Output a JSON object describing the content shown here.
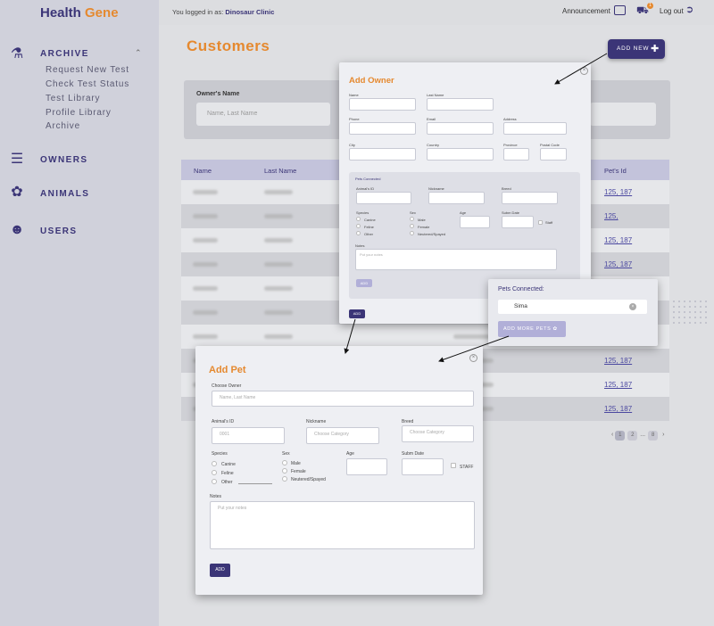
{
  "brand": {
    "part1": "Health",
    "part2": "Gene"
  },
  "topbar": {
    "logged_prefix": "You logged in as:",
    "clinic": "Dinosaur Clinic",
    "announcement": "Announcement",
    "notif_count": "1",
    "logout": "Log out"
  },
  "sidebar": {
    "archive": {
      "label": "ARCHIVE",
      "items": [
        "Request New Test",
        "Check Test Status",
        "Test Library",
        "Profile Library",
        "Archive"
      ]
    },
    "owners": "OWNERS",
    "animals": "ANIMALS",
    "users": "USERS"
  },
  "page": {
    "title": "Customers",
    "add_new": "ADD NEW"
  },
  "filter": {
    "label": "Owner's Name",
    "placeholder": "Name, Last Name"
  },
  "table": {
    "headers": [
      "Name",
      "Last Name",
      "Pet's Id"
    ],
    "rows": [
      {
        "pet_ids": "125, 187"
      },
      {
        "pet_ids": "125,"
      },
      {
        "pet_ids": "125, 187"
      },
      {
        "pet_ids": "125, 187"
      },
      {
        "pet_ids": ""
      },
      {
        "pet_ids": ""
      },
      {
        "pet_ids": ""
      },
      {
        "pet_ids": "125, 187"
      },
      {
        "pet_ids": "125, 187"
      },
      {
        "pet_ids": "125, 187"
      }
    ]
  },
  "pager": {
    "pages": [
      "1",
      "2",
      "...",
      "8"
    ]
  },
  "add_owner": {
    "title": "Add Owner",
    "labels": {
      "name": "Name",
      "last_name": "Last Name",
      "phone": "Phone",
      "email": "Email",
      "address": "Address",
      "city": "City",
      "country": "Country",
      "province": "Province",
      "postal": "Postal Code"
    },
    "pets": {
      "title": "Pets Connected",
      "animal_id": "Animal's ID",
      "nickname": "Nickname",
      "breed": "Breed",
      "species": "Species",
      "species_opts": [
        "Canine",
        "Feline",
        "Other"
      ],
      "sex": "Sex",
      "sex_opts": [
        "Male",
        "Female",
        "Neutered/Spayed"
      ],
      "age": "Age",
      "subm_date": "Subm Date",
      "staff": "Staff",
      "notes": "Notes",
      "notes_ph": "Put your notes",
      "add": "ADD"
    },
    "add": "ADD"
  },
  "pets_connected": {
    "title": "Pets Connected:",
    "pet": "Sima",
    "add_more": "ADD MORE PETS"
  },
  "add_pet": {
    "title": "Add Pet",
    "choose_owner": "Choose Owner",
    "owner_ph": "Name, Last Name",
    "animal_id": "Animal's ID",
    "animal_id_ph": "0001",
    "nickname": "Nickname",
    "nickname_ph": "Choose Category",
    "breed": "Breed",
    "breed_ph": "Choose Category",
    "species": "Species",
    "species_opts": [
      "Canine",
      "Feline",
      "Other"
    ],
    "sex": "Sex",
    "sex_opts": [
      "Male",
      "Female",
      "Neutered/Spayed"
    ],
    "age": "Age",
    "subm_date": "Subm Date",
    "staff": "STAFF",
    "notes": "Notes",
    "notes_ph": "Put your notes",
    "add": "ADD"
  },
  "colors": {
    "primary": "#3b3577",
    "accent": "#e5892f",
    "link": "#4b48a0"
  }
}
